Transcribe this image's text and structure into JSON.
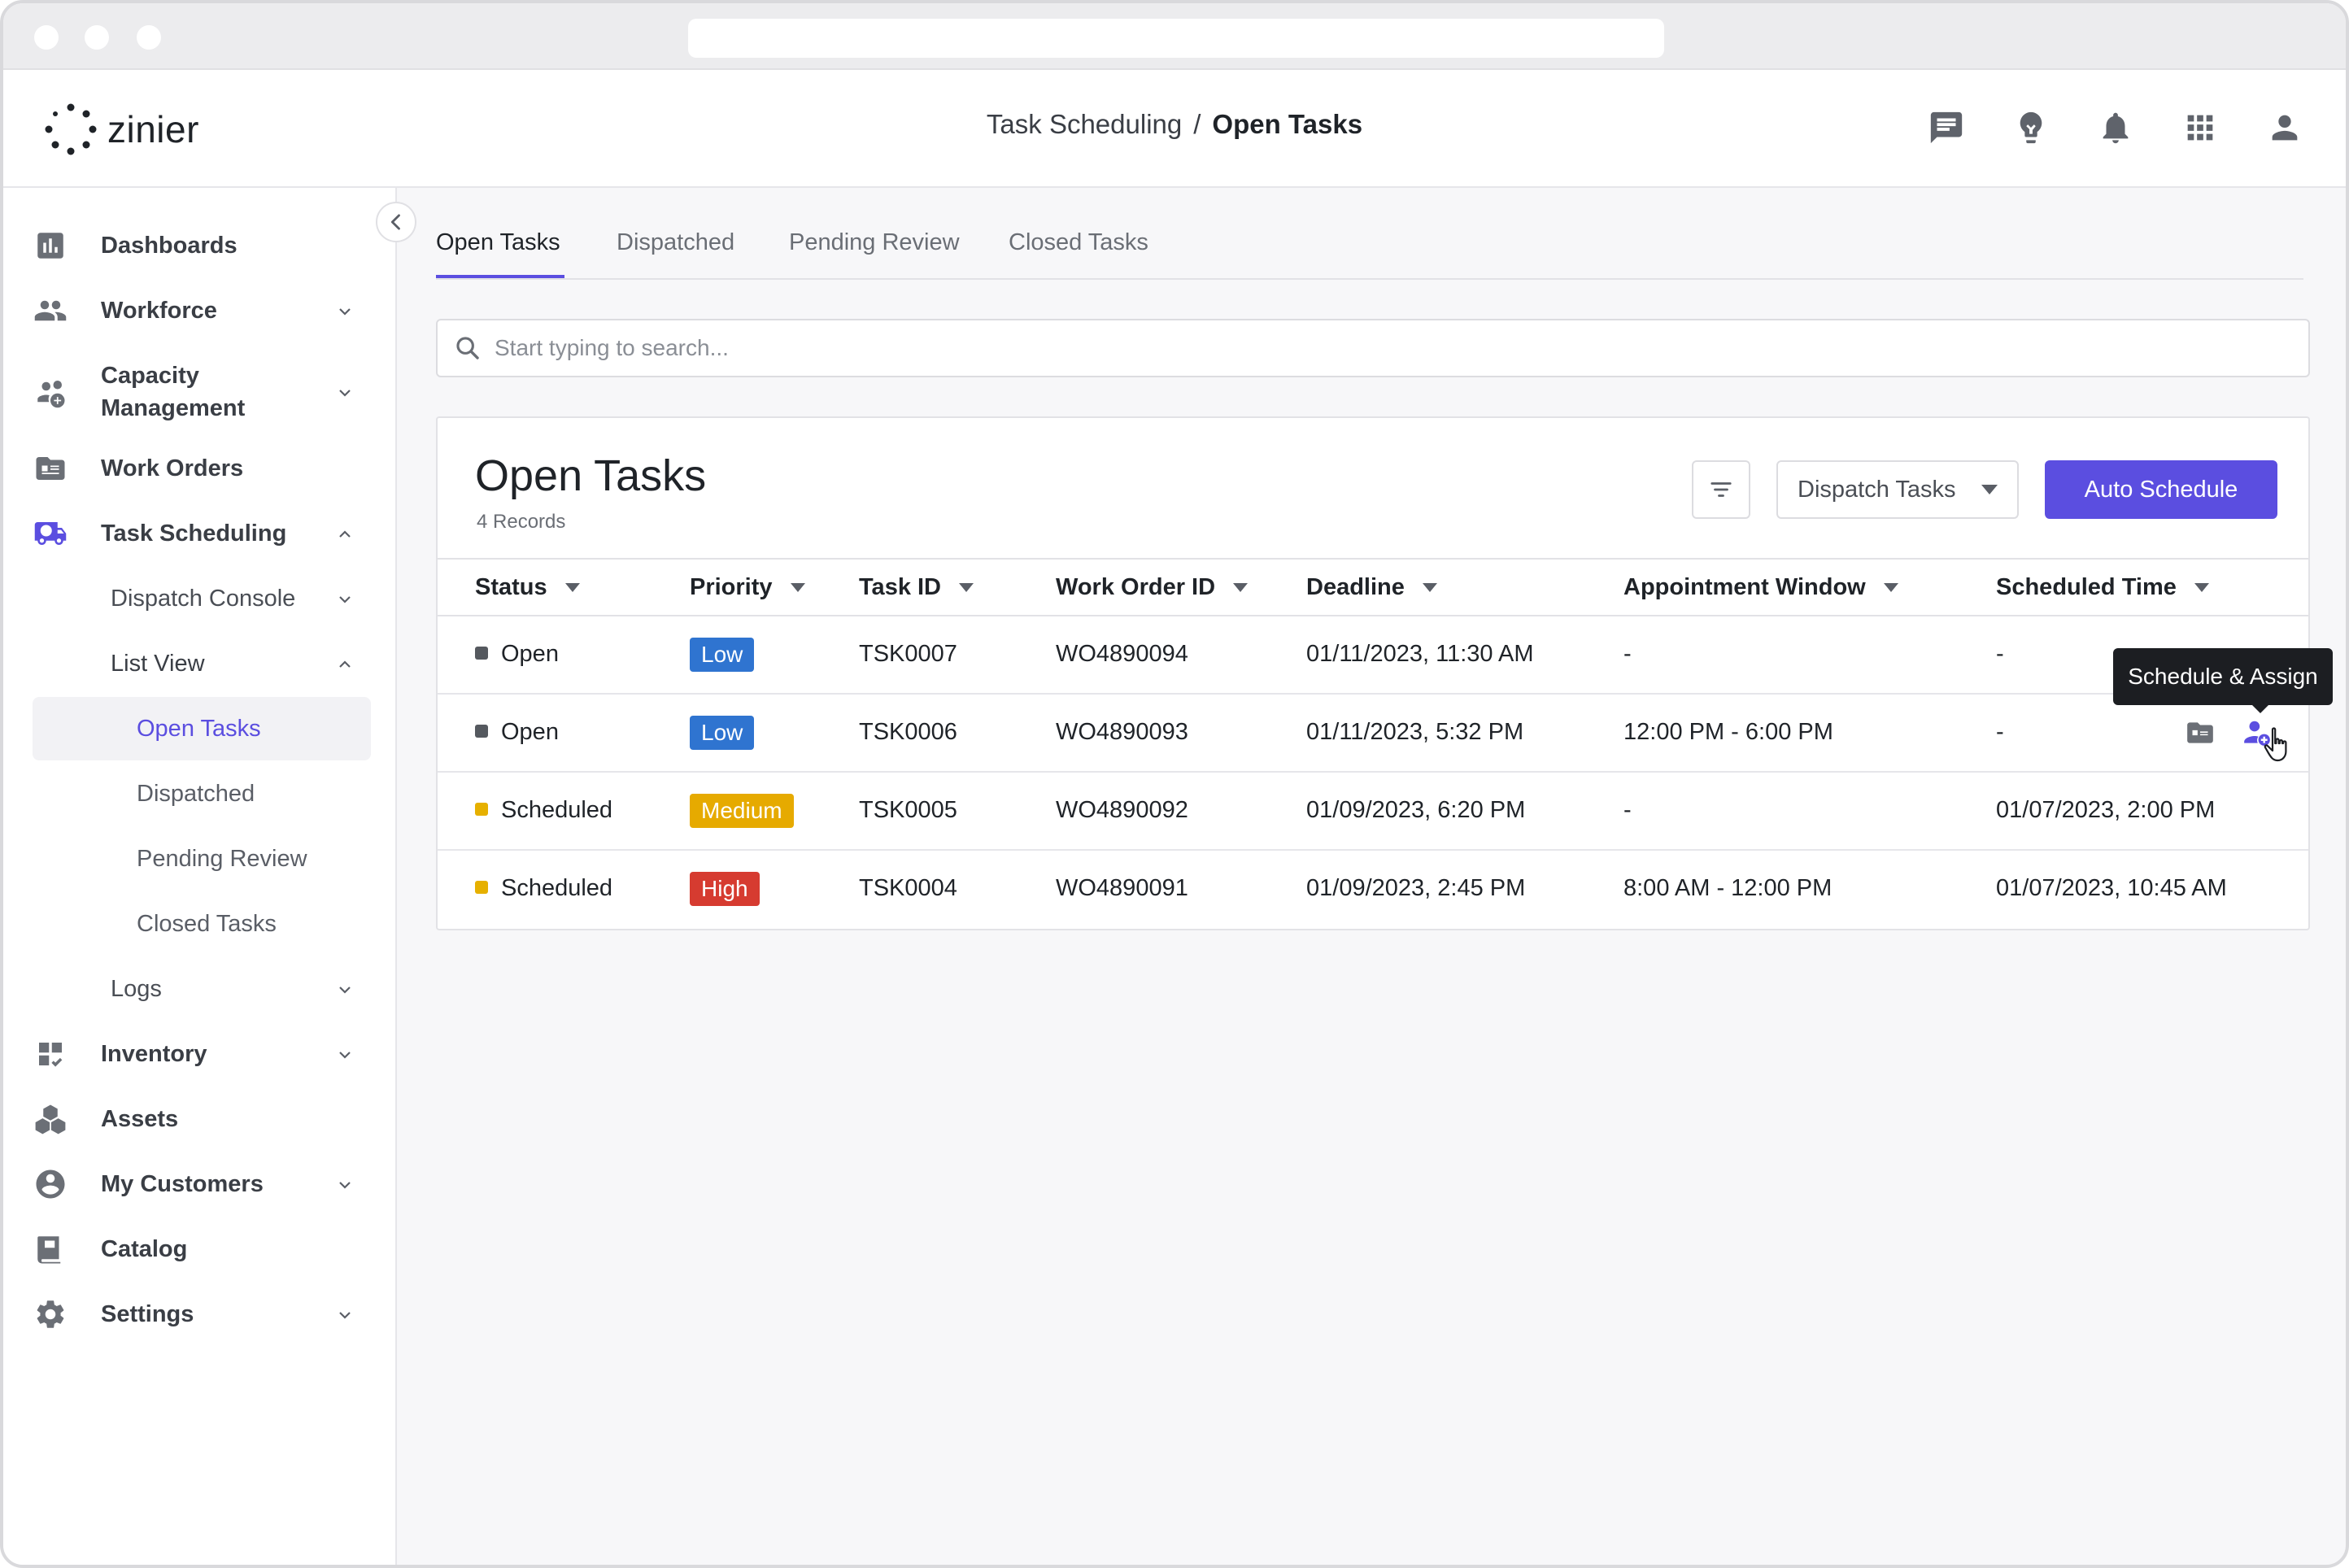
{
  "app": {
    "logo_text": "zinier",
    "breadcrumb_parent": "Task Scheduling",
    "breadcrumb_separator": "/",
    "breadcrumb_current": "Open Tasks",
    "header_icons": [
      "chat-icon",
      "lightbulb-icon",
      "bell-icon",
      "apps-grid-icon",
      "user-icon"
    ]
  },
  "sidebar": {
    "items": [
      {
        "label": "Dashboards",
        "icon": "bar-chart-icon"
      },
      {
        "label": "Workforce",
        "icon": "people-icon"
      },
      {
        "label": "Capacity Management",
        "icon": "capacity-icon"
      },
      {
        "label": "Work Orders",
        "icon": "work-orders-icon"
      },
      {
        "label": "Task Scheduling",
        "icon": "truck-clock-icon"
      },
      {
        "label": "Logs"
      },
      {
        "label": "Inventory",
        "icon": "inventory-icon"
      },
      {
        "label": "Assets",
        "icon": "cubes-icon"
      },
      {
        "label": "My Customers",
        "icon": "account-circle-icon"
      },
      {
        "label": "Catalog",
        "icon": "catalog-icon"
      },
      {
        "label": "Settings",
        "icon": "gear-icon"
      }
    ],
    "capacity_line1": "Capacity",
    "capacity_line2": "Management",
    "sub_items": {
      "dispatch_console": "Dispatch Console",
      "list_view": "List View",
      "open_tasks": "Open Tasks",
      "dispatched": "Dispatched",
      "pending_review": "Pending Review",
      "closed_tasks": "Closed Tasks"
    },
    "accent_color": "#5b4ee0"
  },
  "tabs": [
    "Open Tasks",
    "Dispatched",
    "Pending Review",
    "Closed Tasks"
  ],
  "search": {
    "placeholder": "Start typing to search...",
    "value": ""
  },
  "card": {
    "title": "Open Tasks",
    "records": "4 Records",
    "dispatch_select": "Dispatch Tasks",
    "auto_schedule": "Auto Schedule"
  },
  "table": {
    "columns": [
      "Status",
      "Priority",
      "Task ID",
      "Work Order ID",
      "Deadline",
      "Appointment Window",
      "Scheduled Time"
    ],
    "rows": [
      {
        "status": "Open",
        "priority": "Low",
        "task_id": "TSK0007",
        "work_order_id": "WO4890094",
        "deadline": "01/11/2023, 11:30 AM",
        "window": "-",
        "scheduled": "-"
      },
      {
        "status": "Open",
        "priority": "Low",
        "task_id": "TSK0006",
        "work_order_id": "WO4890093",
        "deadline": "01/11/2023, 5:32 PM",
        "window": "12:00 PM - 6:00 PM",
        "scheduled": "-"
      },
      {
        "status": "Scheduled",
        "priority": "Medium",
        "task_id": "TSK0005",
        "work_order_id": "WO4890092",
        "deadline": "01/09/2023, 6:20 PM",
        "window": "-",
        "scheduled": "01/07/2023, 2:00 PM"
      },
      {
        "status": "Scheduled",
        "priority": "High",
        "task_id": "TSK0004",
        "work_order_id": "WO4890091",
        "deadline": "01/09/2023, 2:45 PM",
        "window": "8:00 AM - 12:00 PM",
        "scheduled": "01/07/2023, 10:45 AM"
      }
    ],
    "status_colors": {
      "Open": "#55595f",
      "Scheduled": "#e6b000"
    },
    "priority_colors": {
      "Low": "#2f74d0",
      "Medium": "#e6aa00",
      "High": "#d63b30"
    }
  },
  "tooltip": "Schedule & Assign"
}
